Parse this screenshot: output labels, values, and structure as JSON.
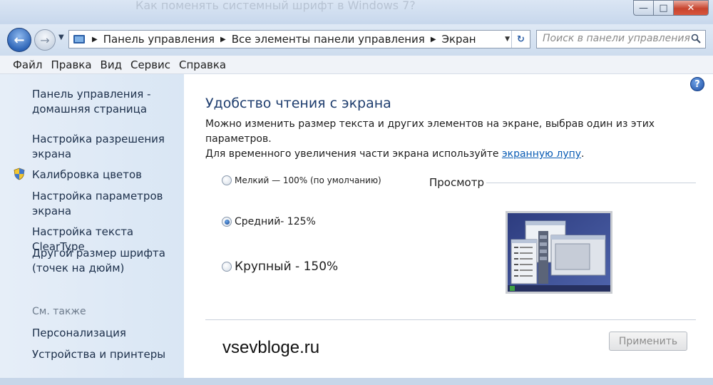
{
  "window": {
    "ghost_title": "Как поменять системный шрифт в Windows 7?",
    "min_symbol": "—",
    "max_symbol": "□",
    "close_symbol": "✕"
  },
  "nav": {
    "back_symbol": "←",
    "forward_symbol": "→",
    "breadcrumbs": [
      "Панель управления",
      "Все элементы панели управления",
      "Экран"
    ],
    "refresh_symbol": "↻",
    "search_placeholder": "Поиск в панели управления"
  },
  "menu": [
    "Файл",
    "Правка",
    "Вид",
    "Сервис",
    "Справка"
  ],
  "sidebar": {
    "items": [
      {
        "label": "Панель управления -\nдомашняя страница"
      },
      {
        "label": "Настройка разрешения\nэкрана"
      },
      {
        "label": "Калибровка цветов"
      },
      {
        "label": "Настройка параметров\nэкрана"
      },
      {
        "label": "Настройка текста ClearType"
      },
      {
        "label": "Другой размер шрифта\n(точек на дюйм)"
      }
    ],
    "see_also_title": "См. также",
    "see_also": [
      "Персонализация",
      "Устройства и принтеры"
    ]
  },
  "main": {
    "help_symbol": "?",
    "title": "Удобство чтения с экрана",
    "desc_line1": "Можно изменить размер текста и других элементов на экране, выбрав один из этих параметров.",
    "desc_line2_prefix": "Для временного увеличения части экрана используйте ",
    "desc_link": "экранную лупу",
    "desc_line2_suffix": ".",
    "options": [
      {
        "label": "Мелкий — 100% (по умолчанию)",
        "selected": false
      },
      {
        "label": "Средний- 125%",
        "selected": true
      },
      {
        "label": "Крупный - 150%",
        "selected": false
      }
    ],
    "preview_label": "Просмотр",
    "watermark": "vsevbloge.ru",
    "apply_label": "Применить"
  }
}
